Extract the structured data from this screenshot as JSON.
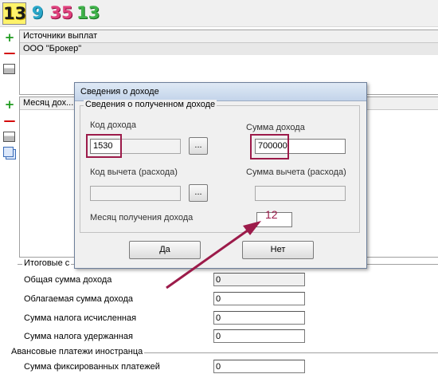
{
  "toolbar": {
    "buttons": [
      "13",
      "9",
      "35",
      "13"
    ]
  },
  "sources_panel": {
    "header": "Источники выплат",
    "rows": [
      "ООО \"Брокер\""
    ]
  },
  "income_panel": {
    "header": "Месяц дох..."
  },
  "summary_section": {
    "title": "Итоговые с",
    "rows": [
      {
        "label": "Общая сумма дохода",
        "value": "0"
      },
      {
        "label": "Облагаемая сумма дохода",
        "value": "0"
      },
      {
        "label": "Сумма налога исчисленная",
        "value": "0"
      },
      {
        "label": "Сумма налога удержанная",
        "value": "0"
      }
    ]
  },
  "advance_section": {
    "title": "Авансовые платежи иностранца",
    "rows": [
      {
        "label": "Сумма фиксированных платежей",
        "value": "0"
      }
    ]
  },
  "dialog": {
    "title": "Сведения о доходе",
    "group_title": "Сведения о полученном доходе",
    "income_code_label": "Код дохода",
    "income_code_value": "1530",
    "income_amount_label": "Сумма дохода",
    "income_amount_value": "700000",
    "deduction_code_label": "Код вычета (расхода)",
    "deduction_code_value": "",
    "deduction_amount_label": "Сумма вычета (расхода)",
    "deduction_amount_value": "",
    "month_label": "Месяц получения дохода",
    "month_value": "",
    "browse_label": "...",
    "yes_label": "Да",
    "no_label": "Нет"
  },
  "annotation": {
    "label": "12",
    "color": "#9c1b4a"
  },
  "icons": {
    "add": "plus-icon",
    "remove": "minus-icon",
    "properties": "properties-icon",
    "copy": "copy-icon"
  }
}
